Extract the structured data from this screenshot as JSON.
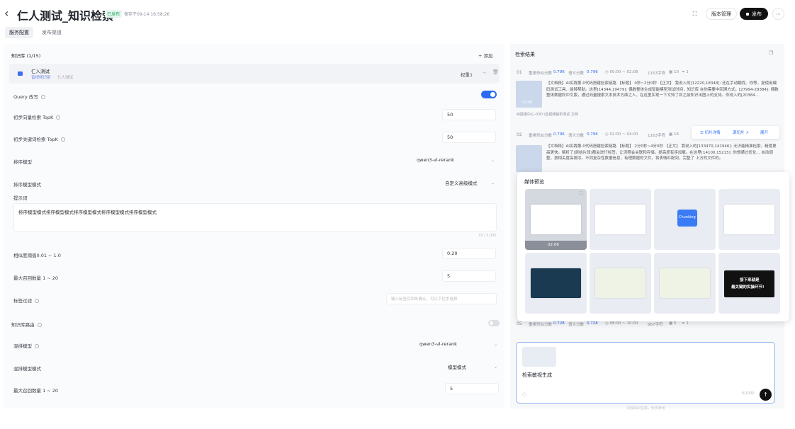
{
  "header": {
    "title": "仁人测试_知识检索",
    "status": "已发布",
    "saved": "保存于09-14 16:58:26",
    "version_btn": "版本管理",
    "publish_btn": "发布"
  },
  "tabs": [
    {
      "label": "服务配置"
    },
    {
      "label": "发布渠道"
    }
  ],
  "kb": {
    "title": "知识库 (1/15)",
    "add": "+ 添加",
    "item_name": "仁人测试",
    "item_tags": "音视频识别",
    "item_owner": "仁人测试",
    "weight": "权重1"
  },
  "form": {
    "query_rewrite": "Query 改写",
    "vector_topk_label": "初步向量检索 TopK",
    "vector_topk": "50",
    "keyword_topk_label": "初步关键词检索 TopK",
    "keyword_topk": "50",
    "rank_model_label": "排序模型",
    "rank_model": "qwen3-vl-rerank",
    "rank_mode_label": "排序模型模式",
    "rank_mode": "自定义高级模式",
    "prompt_label": "提示词",
    "prompt_value": "排序模型模式排序模型模式排序模型模式排序模型模式排序模型模式",
    "prompt_count": "33 / 5,000",
    "threshold_label": "相似度阈值0.01 ~ 1.0",
    "threshold": "0.20",
    "max_recall_label": "最大召回数量 1 ~ 20",
    "max_recall": "5",
    "tag_filter_label": "标签过滤",
    "tag_filter_placeholder": "输入标签后回车确认，可以下拉中选择",
    "kb_route_label": "知识库路由",
    "mix_model_label": "混排模型",
    "mix_model": "qwen3-vl-rerank",
    "mix_mode_label": "混排模型模式",
    "mix_mode": "模型模式",
    "max_recall2_label": "最大召回数量 1 ~ 20",
    "max_recall2": "5"
  },
  "results": {
    "title": "检索结果",
    "r1": {
      "idx": "01",
      "score1": "重排形似分数",
      "v1": "0.796",
      "score2": "语义分数",
      "v2": "0.796",
      "time": "◷ 00:00 ~ 02:08",
      "chars": "1153字符",
      "grid": "10",
      "link": "1",
      "text": "【文档段】AI实践第-0代码搭建检索链路 【标题】 0秒~2分0秒 【正文】 我说入的[12220,18348]: 还在手动翻找、你等，复使用编码测试工具、能够帮助。这里[14344,19479]: 偶数整体生成智能模型测试时间，知识库 在你需要中回溯方式。[27994-29384]: 偶数整体数据同中文版，通过向量搜索文本技术方面之人，在这里实现一下文知了到之前知识出图上的支持。你说入的[20384...",
      "dur": "02:08",
      "src": "AI搭建中心-03D:\\音视频解析测试 ",
      "ch": "文档"
    },
    "r2": {
      "idx": "02",
      "score1": "重排形似分数",
      "v1": "0.796",
      "score2": "语义分数",
      "v2": "0.796",
      "time": "◷ 02:00 ~ 04:00",
      "chars": "1163字符",
      "grid": "16",
      "text": "【文档段】AI实践第-0代码搭建检索链路 【标题】 2分0秒~4分0秒 【正文】 我说入的[133470,141946]: 无识能精准检索，精度更高更快。解析了[原始片段]都会进行标签，让流程会关联和存储，提高度有序加载。在这里[14100,15215]: 你想通过优化... 自动调整，按相关度高排序。不同复杂性数据信息，有理数据的文件、将表情匹配到，完整了 上方的文件的。",
      "act1": "☰ 切片详情",
      "act2": "源切片 ↗",
      "act3": "展开"
    },
    "r5": {
      "idx": "05",
      "score1": "重排形似分数",
      "v1": "0.728",
      "score2": "语义分数",
      "v2": "0.728",
      "time": "◷ 08:00 ~ 10:00",
      "chars": "667字符",
      "grid": "5",
      "link": "1"
    }
  },
  "modal": {
    "title": "媒体预览",
    "first_dur": "02:06",
    "chunking": "Chunking",
    "last_text1": "接下来就是",
    "last_text2": "最关键的实操环节!"
  },
  "composer": {
    "value": "检索敏视生成",
    "count": "6/1000",
    "hint": "内容由AI生成，仅供参考"
  }
}
